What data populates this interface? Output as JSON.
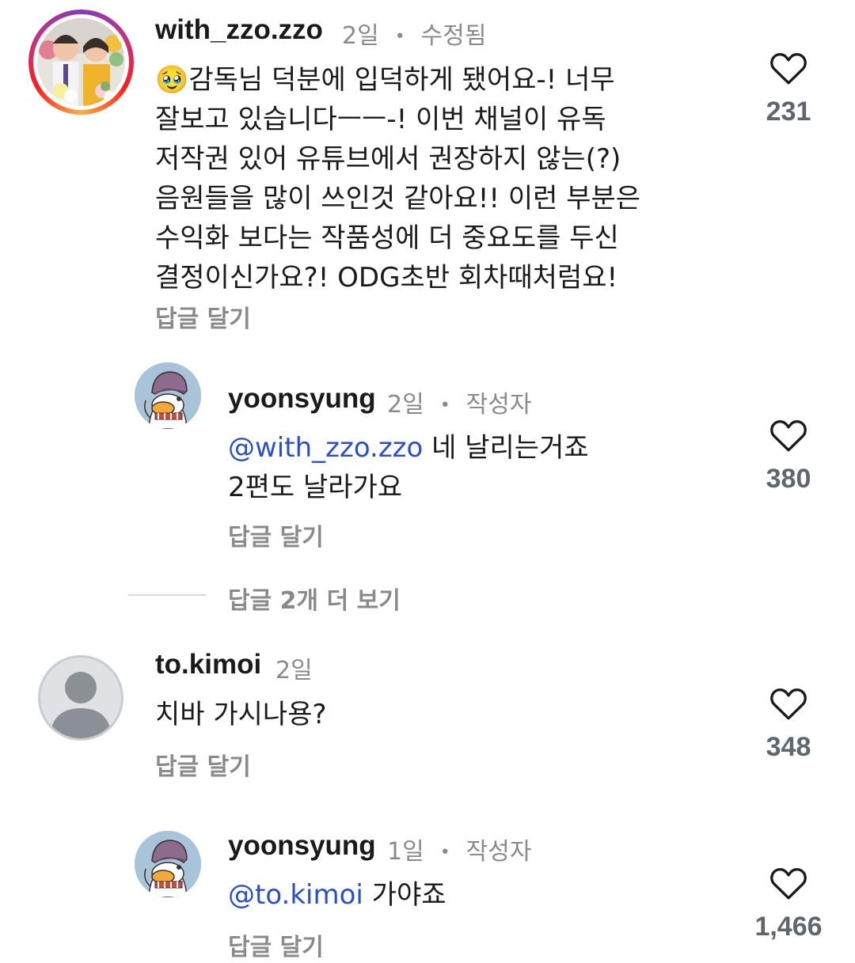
{
  "comments": [
    {
      "username": "with_zzo.zzo",
      "time": "2일",
      "status": "수정됨",
      "lines": [
        "🥹감독님 덕분에 입덕하게 됐어요-! 너무",
        "잘보고 있습니다ㅡㅡ-! 이번 채널이 유독",
        "저작권 있어 유튜브에서 권장하지 않는(?)",
        "음원들을 많이 쓰인것 같아요!! 이런 부분은",
        "수익화 보다는 작품성에 더 중요도를 두신",
        "결정이신가요?! ODG초반 회차때처럼요!"
      ],
      "reply_label": "답글 달기",
      "likes": "231"
    },
    {
      "username": "yoonsyung",
      "time": "2일",
      "badge": "작성자",
      "mention": "@with_zzo.zzo",
      "line1_rest": " 네 날리는거죠",
      "line2": "2편도 날라가요",
      "reply_label": "답글 달기",
      "likes": "380"
    },
    {
      "more_replies": "답글 2개 더 보기"
    },
    {
      "username": "to.kimoi",
      "time": "2일",
      "text": "치바 가시나용?",
      "reply_label": "답글 달기",
      "likes": "348"
    },
    {
      "username": "yoonsyung",
      "time": "1일",
      "badge": "작성자",
      "mention": "@to.kimoi",
      "line1_rest": " 가야죠",
      "reply_label": "답글 달기",
      "likes": "1,466"
    }
  ],
  "icons": {
    "like": "heart-outline-icon",
    "mention": "threads-at-icon"
  },
  "colors": {
    "mention": "#2a4fc9",
    "meta": "#8a8a8a",
    "like_count": "#5e6670"
  }
}
